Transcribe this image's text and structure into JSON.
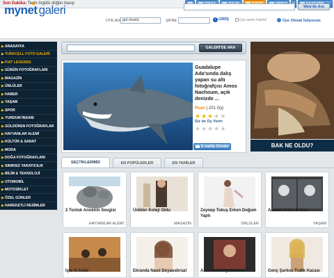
{
  "topbar": {
    "breaking_label": "Son Dakika:",
    "breaking_text": "Terör örgütü düğün basıp",
    "tabs": [
      "EMAIL",
      "OYUN",
      "KAYIT",
      "VİDEO",
      "EKSENİM"
    ],
    "active_tab": "KAYIT"
  },
  "header": {
    "logo_a": "mynet",
    "logo_b": "galeri",
    "search_button": "Web'de Ara",
    "username_label": "ÜYE ADI :",
    "username_value": "gul mustu",
    "password_label": "ŞİFRE :",
    "login_button": "GİRİŞ",
    "remember_label": "Üye adımı hatırla!",
    "signup_link": "Üye Olmak İstiyorum"
  },
  "sidebar": {
    "items": [
      "ANASAYFA",
      "TURKCELL FOTO GALERİ",
      "FIAT LEGENDS",
      "GÜNÜN FOTOĞRAFLARI",
      "MAGAZİN",
      "ÜNLÜLER",
      "HABER",
      "YAŞAM",
      "SPOR",
      "YURDUM İNSANI",
      "GÜLDÜREN FOTOĞRAFLAR",
      "HAYVANLAR ALEMİ",
      "KÜLTÜR & SANAT",
      "MODA",
      "DOĞA FOTOĞRAFLARI",
      "SINIRSIZ YARATICILIK",
      "BİLİM & TEKNOLOJİ",
      "OTOMOBİL",
      "MOTOSİKLET",
      "ÖZEL GÜNLER",
      "HAREKETLİ RESİMLER"
    ],
    "highlighted": [
      "TURKCELL FOTO GALERİ",
      "FIAT LEGENDS"
    ]
  },
  "main_search": {
    "button": "GALERİ'DE ARA"
  },
  "featured": {
    "title": "Guadalupe Ada'sında dalış yapan su altı fotoğrafçısı Amos Nachoum, açık denizde ...",
    "points_label": "Puan",
    "points_value": "( 201 Oy)",
    "vote_label": "Siz de Oy Verin",
    "rating": 3,
    "send_mail": "E-mailla Gönder"
  },
  "ad": {
    "banner": "BAK NE OLDU?"
  },
  "tabs": [
    {
      "label": "SEÇTİKLERİMİZ",
      "active": true
    },
    {
      "label": "EN POPÜLERLER",
      "active": false
    },
    {
      "label": "EN YENİLER",
      "active": false
    }
  ],
  "cards": [
    {
      "title": "2 Tonluk Annenin Sevgisi",
      "category": "HAYVANLAR ALEMİ"
    },
    {
      "title": "Ünlüler Koleji Oldu",
      "category": "MAGAZİN"
    },
    {
      "title": "Zeynep Tokuş Erken Doğum Yaptı",
      "category": "ÜNLÜLER"
    },
    {
      "title": "Aradaki Farkı Bulun!",
      "category": "YAŞAM"
    },
    {
      "title": "İşte O Anlar",
      "category": ""
    },
    {
      "title": "Ekranda Nasıl Doyasıdırsa!",
      "category": ""
    },
    {
      "title": "Aramızdan Ayrılanlar",
      "category": ""
    },
    {
      "title": "Genç Şarkıcı Trafik Kazası",
      "category": ""
    }
  ],
  "colors": {
    "sidebar_bg": "#0d2233",
    "accent_blue": "#1d60b5",
    "accent_orange": "#f08a00",
    "ad_banner_bg": "#0e2c44"
  }
}
